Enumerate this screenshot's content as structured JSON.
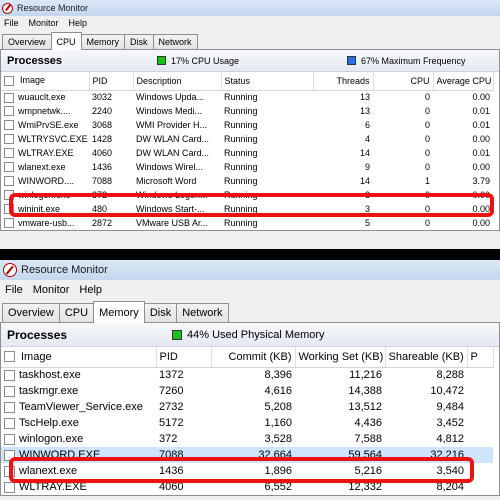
{
  "top_window": {
    "title": "Resource Monitor",
    "menu": [
      "File",
      "Monitor",
      "Help"
    ],
    "tabs": [
      "Overview",
      "CPU",
      "Memory",
      "Disk",
      "Network"
    ],
    "active_tab": "CPU",
    "section_title": "Processes",
    "stat1": "17% CPU Usage",
    "stat2": "67% Maximum Frequency",
    "columns": [
      "Image",
      "PID",
      "Description",
      "Status",
      "Threads",
      "CPU",
      "Average CPU"
    ],
    "rows": [
      [
        "wuauclt.exe",
        "3032",
        "Windows Upda...",
        "Running",
        "13",
        "0",
        "0.00"
      ],
      [
        "wmpnetwk....",
        "2240",
        "Windows Medi...",
        "Running",
        "13",
        "0",
        "0.01"
      ],
      [
        "WmiPrvSE.exe",
        "3068",
        "WMI Provider H...",
        "Running",
        "6",
        "0",
        "0.01"
      ],
      [
        "WLTRYSVC.EXE",
        "1428",
        "DW WLAN Card...",
        "Running",
        "4",
        "0",
        "0.00"
      ],
      [
        "WLTRAY.EXE",
        "4060",
        "DW WLAN Card...",
        "Running",
        "14",
        "0",
        "0.01"
      ],
      [
        "wlanext.exe",
        "1436",
        "Windows Wirel...",
        "Running",
        "9",
        "0",
        "0.00"
      ],
      [
        "WINWORD....",
        "7088",
        "Microsoft Word",
        "Running",
        "14",
        "1",
        "3.79"
      ],
      [
        "winlogon.exe",
        "372",
        "Windows Logon...",
        "Running",
        "3",
        "0",
        "0.00"
      ],
      [
        "wininit.exe",
        "480",
        "Windows Start-...",
        "Running",
        "3",
        "0",
        "0.00"
      ],
      [
        "vmware-usb...",
        "2872",
        "VMware USB Ar...",
        "Running",
        "5",
        "0",
        "0.00"
      ]
    ]
  },
  "bottom_window": {
    "title": "Resource Monitor",
    "menu": [
      "File",
      "Monitor",
      "Help"
    ],
    "tabs": [
      "Overview",
      "CPU",
      "Memory",
      "Disk",
      "Network"
    ],
    "active_tab": "Memory",
    "section_title": "Processes",
    "stat1": "44% Used Physical Memory",
    "columns": [
      "Image",
      "PID",
      "Commit (KB)",
      "Working Set (KB)",
      "Shareable (KB)",
      "P"
    ],
    "rows": [
      [
        "taskhost.exe",
        "1372",
        "8,396",
        "11,216",
        "8,288",
        ""
      ],
      [
        "taskmgr.exe",
        "7260",
        "4,616",
        "14,388",
        "10,472",
        ""
      ],
      [
        "TeamViewer_Service.exe",
        "2732",
        "5,208",
        "13,512",
        "9,484",
        ""
      ],
      [
        "TscHelp.exe",
        "5172",
        "1,160",
        "4,436",
        "3,452",
        ""
      ],
      [
        "winlogon.exe",
        "372",
        "3,528",
        "7,588",
        "4,812",
        ""
      ],
      [
        "WINWORD.EXE",
        "7088",
        "32,664",
        "59,564",
        "32,216",
        ""
      ],
      [
        "wlanext.exe",
        "1436",
        "1,896",
        "5,216",
        "3,540",
        ""
      ],
      [
        "WLTRAY.EXE",
        "4060",
        "6,552",
        "12,332",
        "8,204",
        ""
      ]
    ]
  },
  "colors": {
    "highlight": "#e11111",
    "selected_row": "#cde4fa"
  }
}
